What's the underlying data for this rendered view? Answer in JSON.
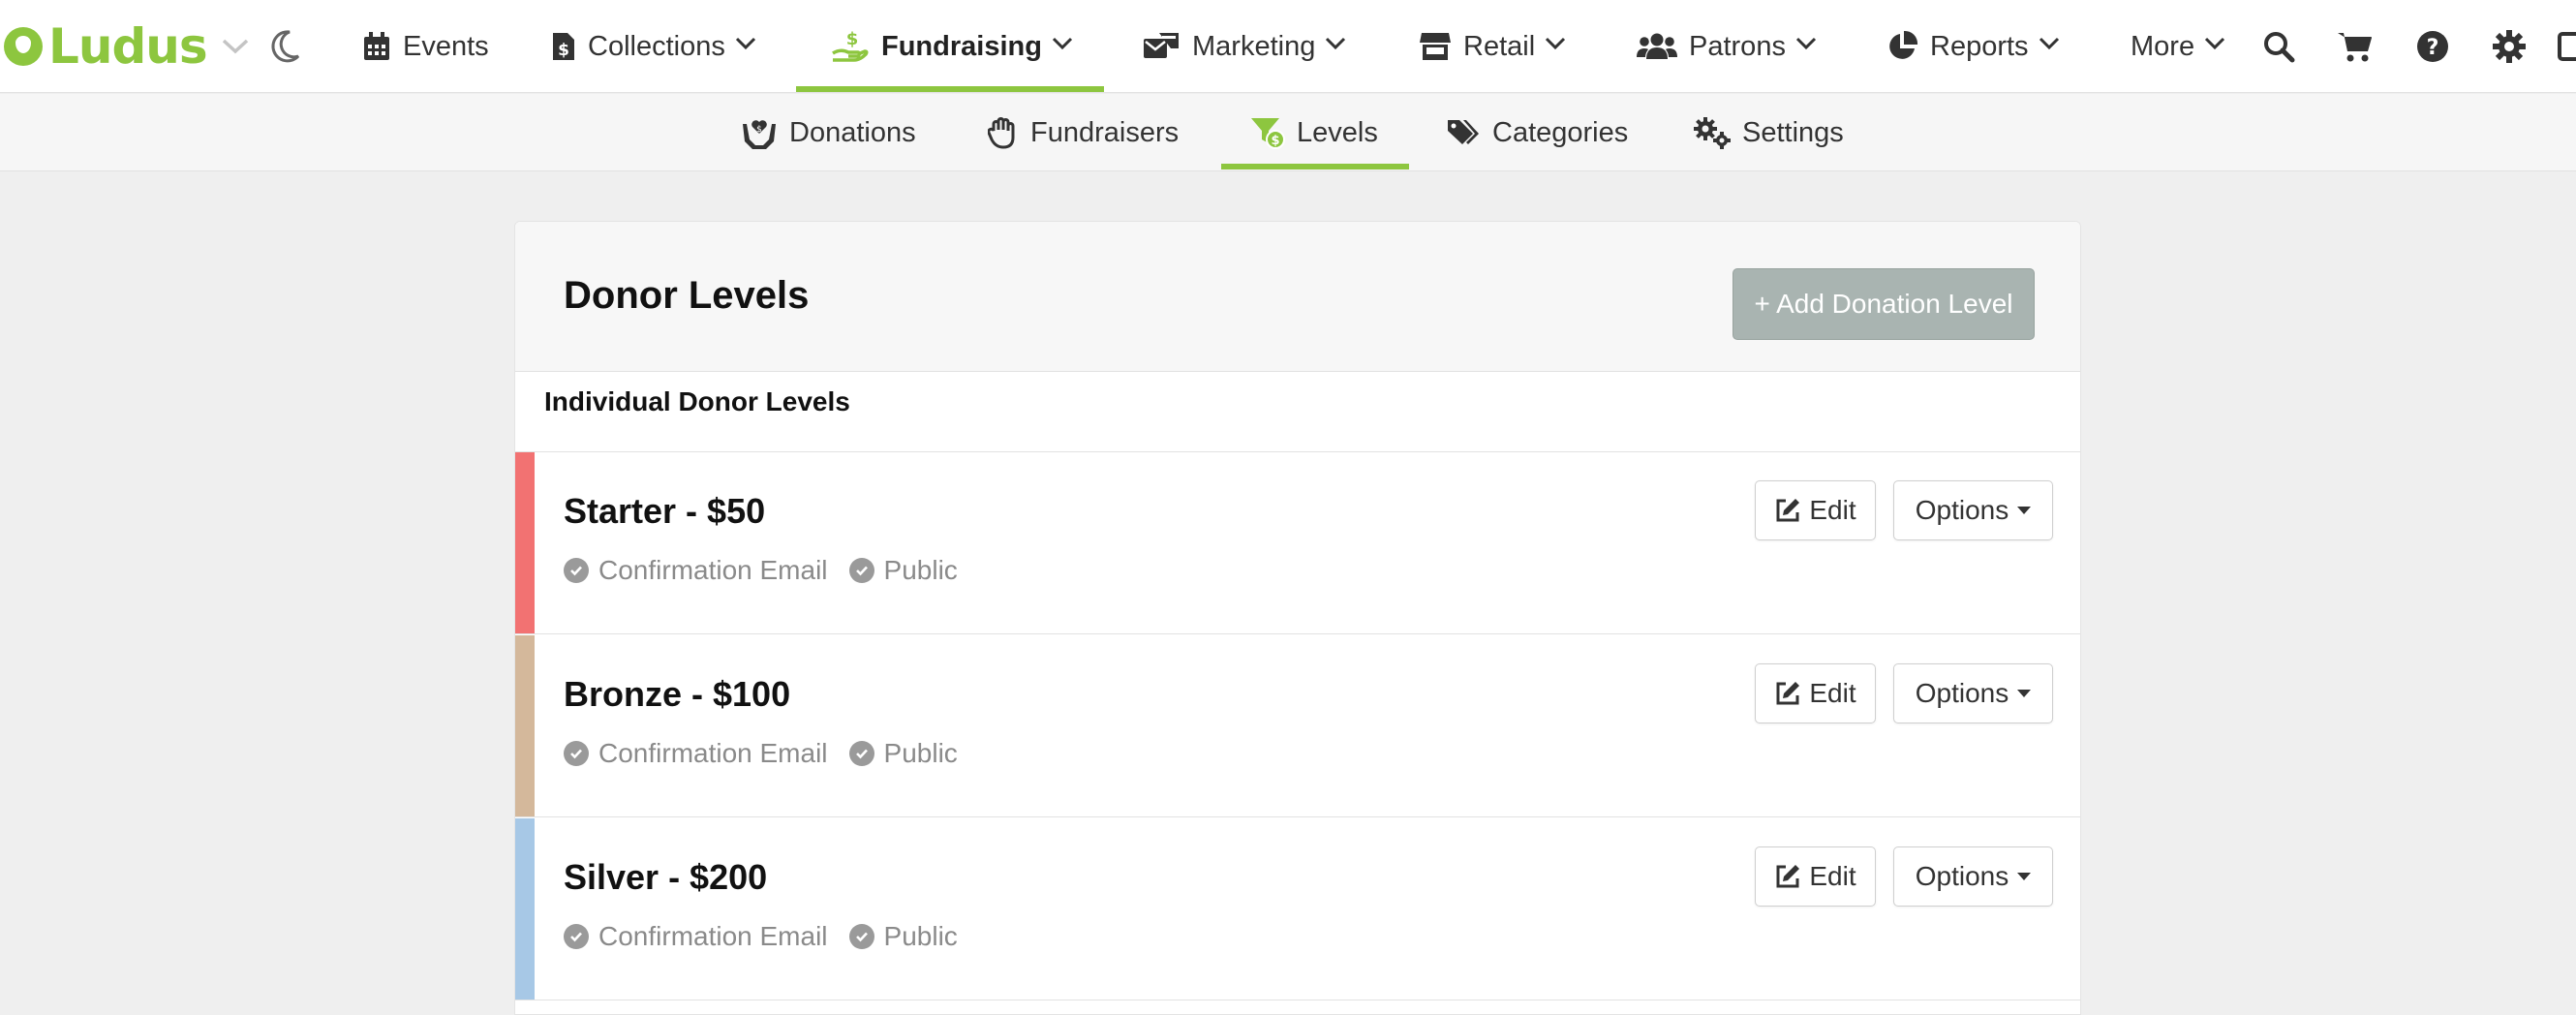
{
  "brand": {
    "name": "Ludus",
    "color": "#8dc63f"
  },
  "topnav": {
    "items": [
      {
        "label": "Events",
        "icon": "calendar-icon"
      },
      {
        "label": "Collections",
        "icon": "dollar-file-icon"
      },
      {
        "label": "Fundraising",
        "icon": "hand-coin-icon",
        "active": true
      },
      {
        "label": "Marketing",
        "icon": "mail-bullhorn-icon"
      },
      {
        "label": "Retail",
        "icon": "store-icon"
      },
      {
        "label": "Patrons",
        "icon": "users-icon"
      },
      {
        "label": "Reports",
        "icon": "pie-chart-icon"
      },
      {
        "label": "More"
      }
    ],
    "tools": [
      "search-icon",
      "cart-icon",
      "help-icon",
      "gear-icon"
    ]
  },
  "subnav": {
    "items": [
      {
        "label": "Donations",
        "icon": "hand-heart-icon"
      },
      {
        "label": "Fundraisers",
        "icon": "raised-hand-icon"
      },
      {
        "label": "Levels",
        "icon": "funnel-dollar-icon",
        "active": true
      },
      {
        "label": "Categories",
        "icon": "tags-icon"
      },
      {
        "label": "Settings",
        "icon": "gears-icon"
      }
    ]
  },
  "card": {
    "title": "Donor Levels",
    "add_button": "+ Add Donation Level",
    "section_title": "Individual Donor Levels",
    "edit_label": "Edit",
    "options_label": "Options",
    "levels": [
      {
        "title": "Starter - $50",
        "color": "#f27272",
        "tags": [
          "Confirmation Email",
          "Public"
        ]
      },
      {
        "title": "Bronze - $100",
        "color": "#d4b89b",
        "tags": [
          "Confirmation Email",
          "Public"
        ]
      },
      {
        "title": "Silver - $200",
        "color": "#a7c8e6",
        "tags": [
          "Confirmation Email",
          "Public"
        ]
      }
    ]
  }
}
